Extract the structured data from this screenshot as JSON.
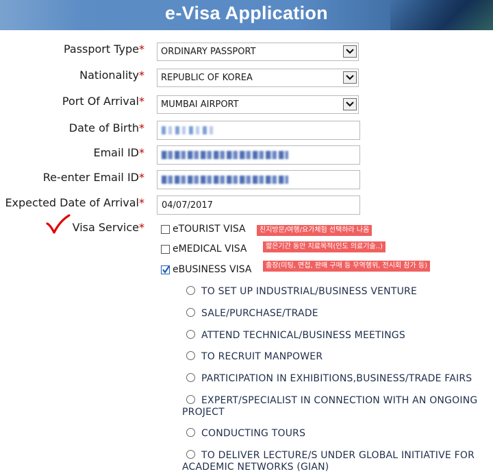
{
  "header": {
    "title": "e-Visa Application"
  },
  "form": {
    "passport_type": {
      "label": "Passport Type",
      "value": "ORDINARY PASSPORT"
    },
    "nationality": {
      "label": "Nationality",
      "value": "REPUBLIC OF KOREA"
    },
    "port_of_arrival": {
      "label": "Port Of Arrival",
      "value": "MUMBAI AIRPORT"
    },
    "date_of_birth": {
      "label": "Date of Birth"
    },
    "email": {
      "label": "Email ID"
    },
    "reenter_email": {
      "label": "Re-enter Email ID"
    },
    "arrival_date": {
      "label": "Expected Date of Arrival",
      "value": "04/07/2017"
    },
    "required_mark": "*",
    "visa_service": {
      "label": "Visa Service",
      "options": [
        {
          "label": "eTOURIST VISA",
          "checked": false,
          "note": "친지방문/여행/요가체험 선택하라 나옴"
        },
        {
          "label": "eMEDICAL VISA",
          "checked": false,
          "note": "짧은기간 동안 치료목적(인도 의료기술..)"
        },
        {
          "label": "eBUSINESS VISA",
          "checked": true,
          "note": "출장(미팅, 면접, 판매 구매 등 무역행위, 전시회 참가 등)"
        }
      ],
      "business_purposes": [
        "TO SET UP INDUSTRIAL/BUSINESS VENTURE",
        "SALE/PURCHASE/TRADE",
        "ATTEND TECHNICAL/BUSINESS MEETINGS",
        "TO RECRUIT MANPOWER",
        "PARTICIPATION IN EXHIBITIONS,BUSINESS/TRADE FAIRS",
        "EXPERT/SPECIALIST IN CONNECTION WITH AN ONGOING",
        "PROJECT",
        "CONDUCTING TOURS",
        "TO DELIVER LECTURE/S UNDER GLOBAL INITIATIVE FOR",
        "ACADEMIC NETWORKS (GIAN)"
      ]
    }
  },
  "colors": {
    "required": "#c00000",
    "note_bg": "#f06060",
    "header_bg": "#5a8ac4",
    "check": "#1e5eb8"
  },
  "icons": {
    "dropdown": "chevron-down-icon",
    "annotation": "red-checkmark-icon"
  }
}
